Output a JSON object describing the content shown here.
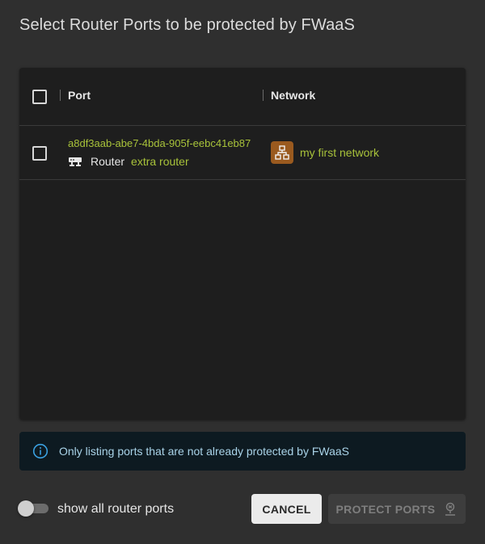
{
  "dialog": {
    "title": "Select Router Ports to be protected by FWaaS"
  },
  "table": {
    "columns": [
      "Port",
      "Network"
    ],
    "rows": [
      {
        "port_id": "a8df3aab-abe7-4bda-905f-eebc41eb87",
        "router_label": "Router",
        "router_name": "extra router",
        "network_name": "my first network"
      }
    ]
  },
  "info": {
    "text": "Only listing ports that are not already protected by FWaaS"
  },
  "footer": {
    "toggle_label": "show all router ports",
    "toggle_on": false,
    "cancel_label": "CANCEL",
    "protect_label": "PROTECT PORTS"
  },
  "colors": {
    "accent_link": "#a8c23a",
    "network_icon_bg": "#9a5a1f",
    "info_bg": "#0d1a21",
    "info_text": "#a9d3e8"
  }
}
